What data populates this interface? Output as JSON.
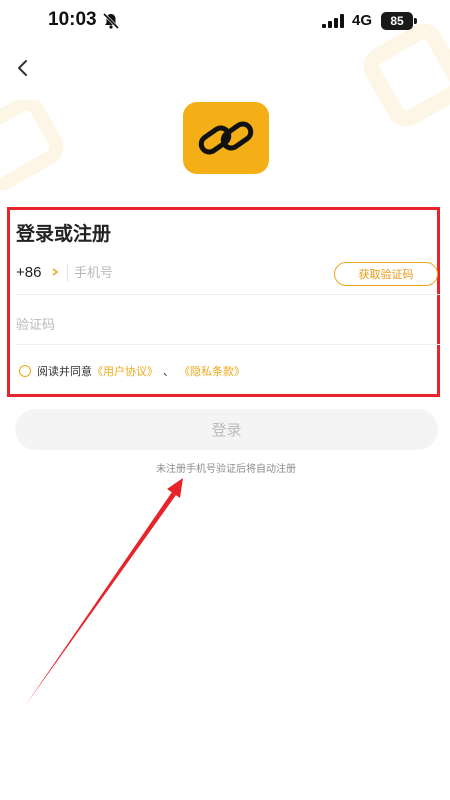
{
  "status_bar": {
    "time": "10:03",
    "network": "4G",
    "battery": "85"
  },
  "login_form": {
    "title": "登录或注册",
    "country_code": "+86",
    "phone_placeholder": "手机号",
    "get_code_label": "获取验证码",
    "code_placeholder": "验证码",
    "agreement": {
      "prefix": "阅读并同意",
      "user_agreement": "《用户协议》",
      "separator": "、",
      "privacy_policy": "《隐私条款》"
    },
    "login_label": "登录",
    "auto_register_note": "未注册手机号验证后将自动注册"
  },
  "icons": {
    "back": "chevron-left-icon",
    "app_logo": "chain-link-icon",
    "mute": "bell-slash-icon"
  },
  "colors": {
    "brand": "#F5AF16",
    "accent_text": "#F0A818",
    "highlight": "#E8242B"
  }
}
